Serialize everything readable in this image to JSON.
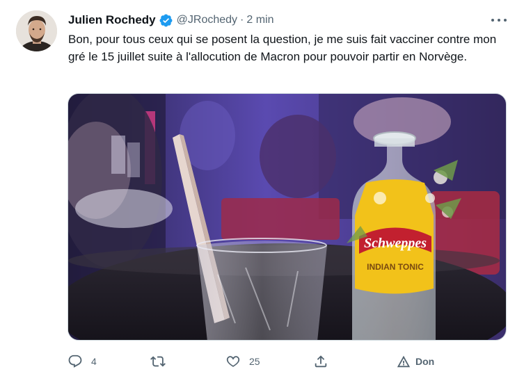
{
  "tweet": {
    "author_name": "Julien Rochedy",
    "handle": "@JRochedy",
    "separator": "·",
    "time": "2 min",
    "text": "Bon, pour tous ceux qui se posent la question, je me suis fait vacciner contre mon gré le 15 juillet suite à l'allocution de Macron pour pouvoir partir en Norvège.",
    "media": {
      "bottle_brand": "Schweppes",
      "bottle_label": "INDIAN TONIC"
    }
  },
  "actions": {
    "reply_count": "4",
    "retweet_count": "",
    "like_count": "25",
    "translate_label": "Don"
  },
  "colors": {
    "text": "#0f1419",
    "secondary": "#536471",
    "verified": "#1d9bf0"
  },
  "icons": [
    "verified-badge-icon",
    "more-options-icon",
    "reply-icon",
    "retweet-icon",
    "like-icon",
    "share-icon",
    "translate-icon"
  ]
}
